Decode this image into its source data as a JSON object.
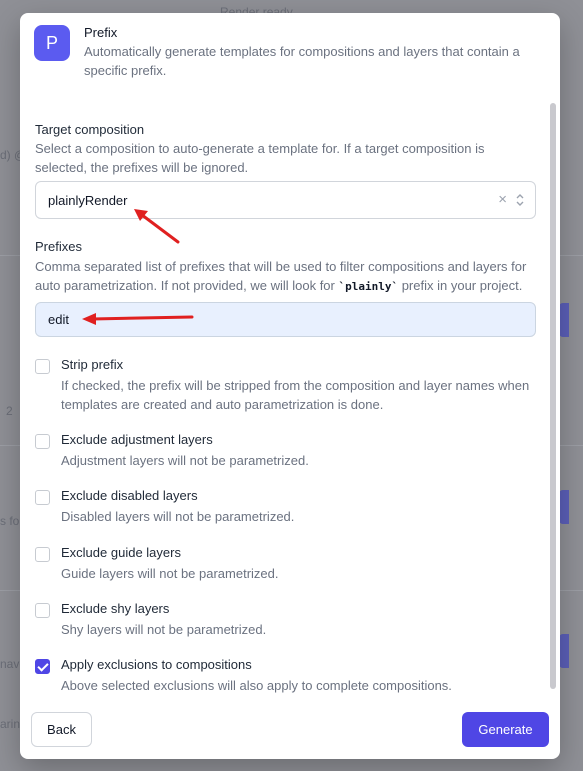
{
  "background": {
    "status_text": "Render ready",
    "fragments": [
      "d) @",
      "2",
      "s fo",
      "nave",
      "arin"
    ]
  },
  "header": {
    "logo_letter": "P",
    "title": "Prefix",
    "description": "Automatically generate templates for compositions and layers that contain a specific prefix."
  },
  "target_composition": {
    "label": "Target composition",
    "help": "Select a composition to auto-generate a template for. If a target composition is selected, the prefixes will be ignored.",
    "value": "plainlyRender",
    "clear_symbol": "×"
  },
  "prefixes": {
    "label": "Prefixes",
    "help_before": "Comma separated list of prefixes that will be used to filter compositions and layers for auto parametrization. If not provided, we will look for ",
    "help_code": "`plainly`",
    "help_after": " prefix in your project.",
    "value": "edit"
  },
  "options": [
    {
      "title": "Strip prefix",
      "description": "If checked, the prefix will be stripped from the composition and layer names when templates are created and auto parametrization is done.",
      "checked": false
    },
    {
      "title": "Exclude adjustment layers",
      "description": "Adjustment layers will not be parametrized.",
      "checked": false
    },
    {
      "title": "Exclude disabled layers",
      "description": "Disabled layers will not be parametrized.",
      "checked": false
    },
    {
      "title": "Exclude guide layers",
      "description": "Guide layers will not be parametrized.",
      "checked": false
    },
    {
      "title": "Exclude shy layers",
      "description": "Shy layers will not be parametrized.",
      "checked": false
    },
    {
      "title": "Apply exclusions to compositions",
      "description": "Above selected exclusions will also apply to complete compositions.",
      "checked": true
    }
  ],
  "footer": {
    "back_label": "Back",
    "generate_label": "Generate"
  },
  "colors": {
    "accent": "#4f46e5",
    "logo": "#5b5bf0",
    "annotation_arrow": "#e02020"
  }
}
